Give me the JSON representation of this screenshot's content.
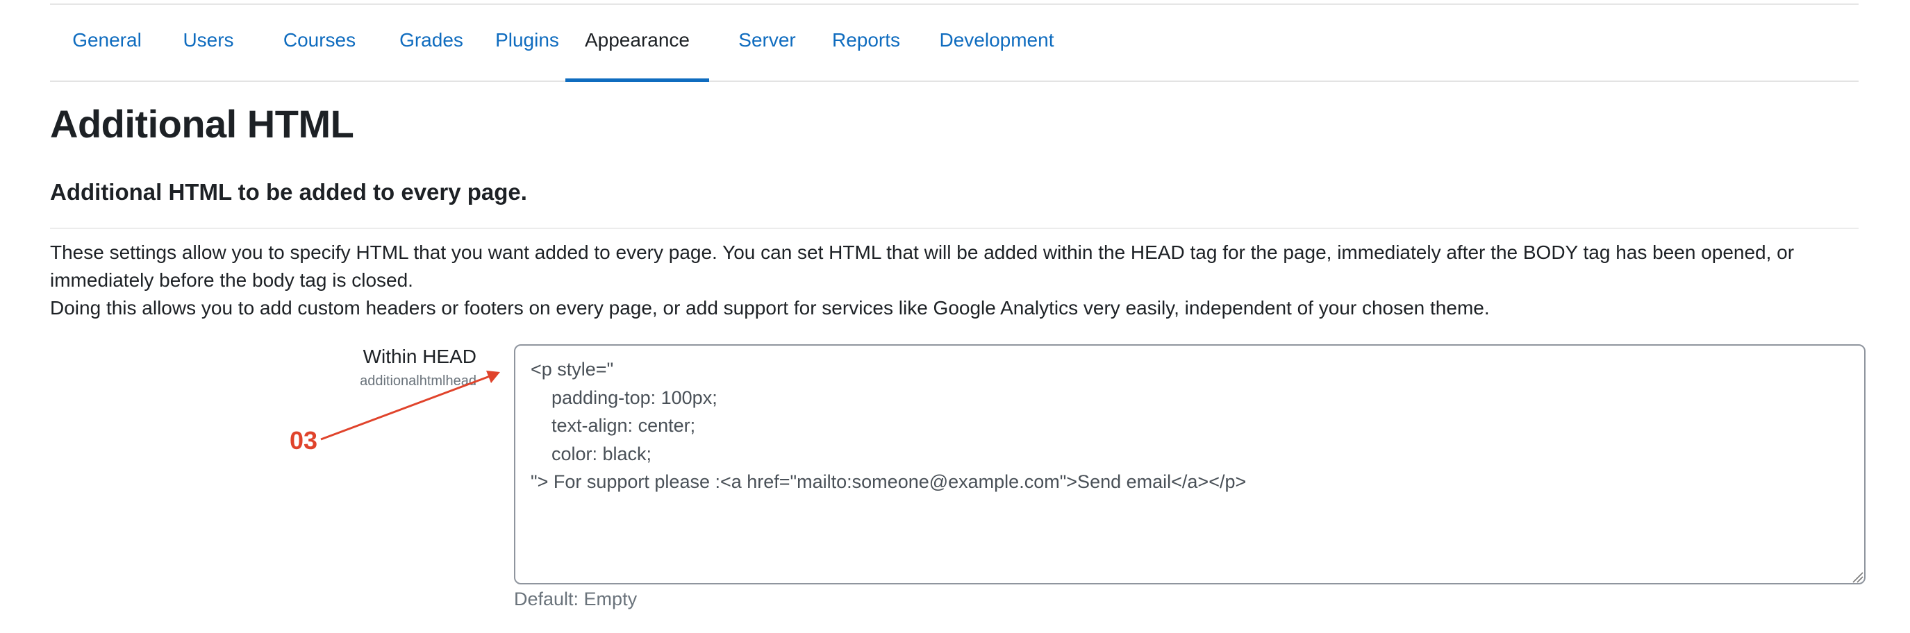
{
  "tabs": [
    {
      "label": "General"
    },
    {
      "label": "Users"
    },
    {
      "label": "Courses"
    },
    {
      "label": "Grades"
    },
    {
      "label": "Plugins"
    },
    {
      "label": "Appearance",
      "active": true
    },
    {
      "label": "Server"
    },
    {
      "label": "Reports"
    },
    {
      "label": "Development"
    }
  ],
  "page": {
    "title": "Additional HTML",
    "section_title": "Additional HTML to be added to every page.",
    "description_line1": "These settings allow you to specify HTML that you want added to every page. You can set HTML that will be added within the HEAD tag for the page, immediately after the BODY tag has been opened, or immediately before the body tag is closed.",
    "description_line2": "Doing this allows you to add custom headers or footers on every page, or add support for services like Google Analytics very easily, independent of your chosen theme."
  },
  "setting": {
    "label": "Within HEAD",
    "key": "additionalhtmlhead",
    "value": "<p style=\"\n    padding-top: 100px;\n    text-align: center;\n    color: black;\n\"> For support please :<a href=\"mailto:someone@example.com\">Send email</a></p>",
    "default_text": "Default: Empty"
  },
  "annotation": {
    "label": "03",
    "color": "#e0432b"
  },
  "colors": {
    "link": "#0f6cbf",
    "text": "#1d2125",
    "muted": "#6a737b",
    "annotation": "#e0432b"
  }
}
